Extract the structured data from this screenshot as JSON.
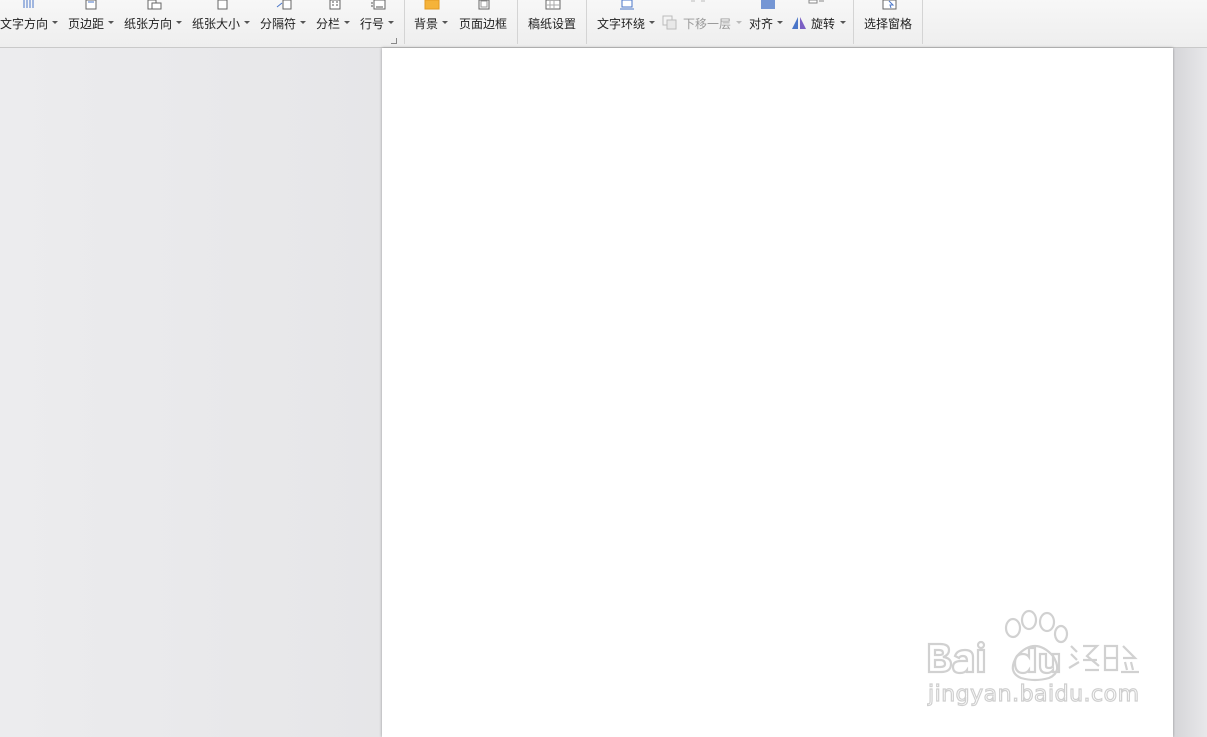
{
  "toolbar": {
    "buttons": [
      {
        "id": "text-direction",
        "label": "文字方向",
        "icon": "text-direction-icon"
      },
      {
        "id": "margins",
        "label": "页边距",
        "icon": "margins-icon"
      },
      {
        "id": "orientation",
        "label": "纸张方向",
        "icon": "orientation-icon"
      },
      {
        "id": "paper-size",
        "label": "纸张大小",
        "icon": "paper-size-icon"
      },
      {
        "id": "breaks",
        "label": "分隔符",
        "icon": "breaks-icon"
      },
      {
        "id": "columns",
        "label": "分栏",
        "icon": "columns-icon"
      },
      {
        "id": "line-numbers",
        "label": "行号",
        "icon": "line-numbers-icon"
      },
      {
        "id": "background",
        "label": "背景",
        "icon": "background-icon"
      },
      {
        "id": "page-border",
        "label": "页面边框",
        "icon": "page-border-icon"
      },
      {
        "id": "manuscript",
        "label": "稿纸设置",
        "icon": "manuscript-icon"
      },
      {
        "id": "text-wrap",
        "label": "文字环绕",
        "icon": "text-wrap-icon"
      },
      {
        "id": "send-backward",
        "label": "下移一层",
        "icon": "send-backward-icon"
      },
      {
        "id": "align",
        "label": "对齐",
        "icon": "align-icon"
      },
      {
        "id": "rotate",
        "label": "旋转",
        "icon": "rotate-icon"
      },
      {
        "id": "selection-pane",
        "label": "选择窗格",
        "icon": "selection-pane-icon"
      }
    ]
  },
  "colors": {
    "toolbar_bg": "#f2f2f2",
    "workspace_bg": "#e4e5e8",
    "page_bg": "#ffffff",
    "accent_orange": "#f5b33a",
    "accent_blue": "#4a76c8",
    "accent_purple": "#7b5fc4"
  }
}
